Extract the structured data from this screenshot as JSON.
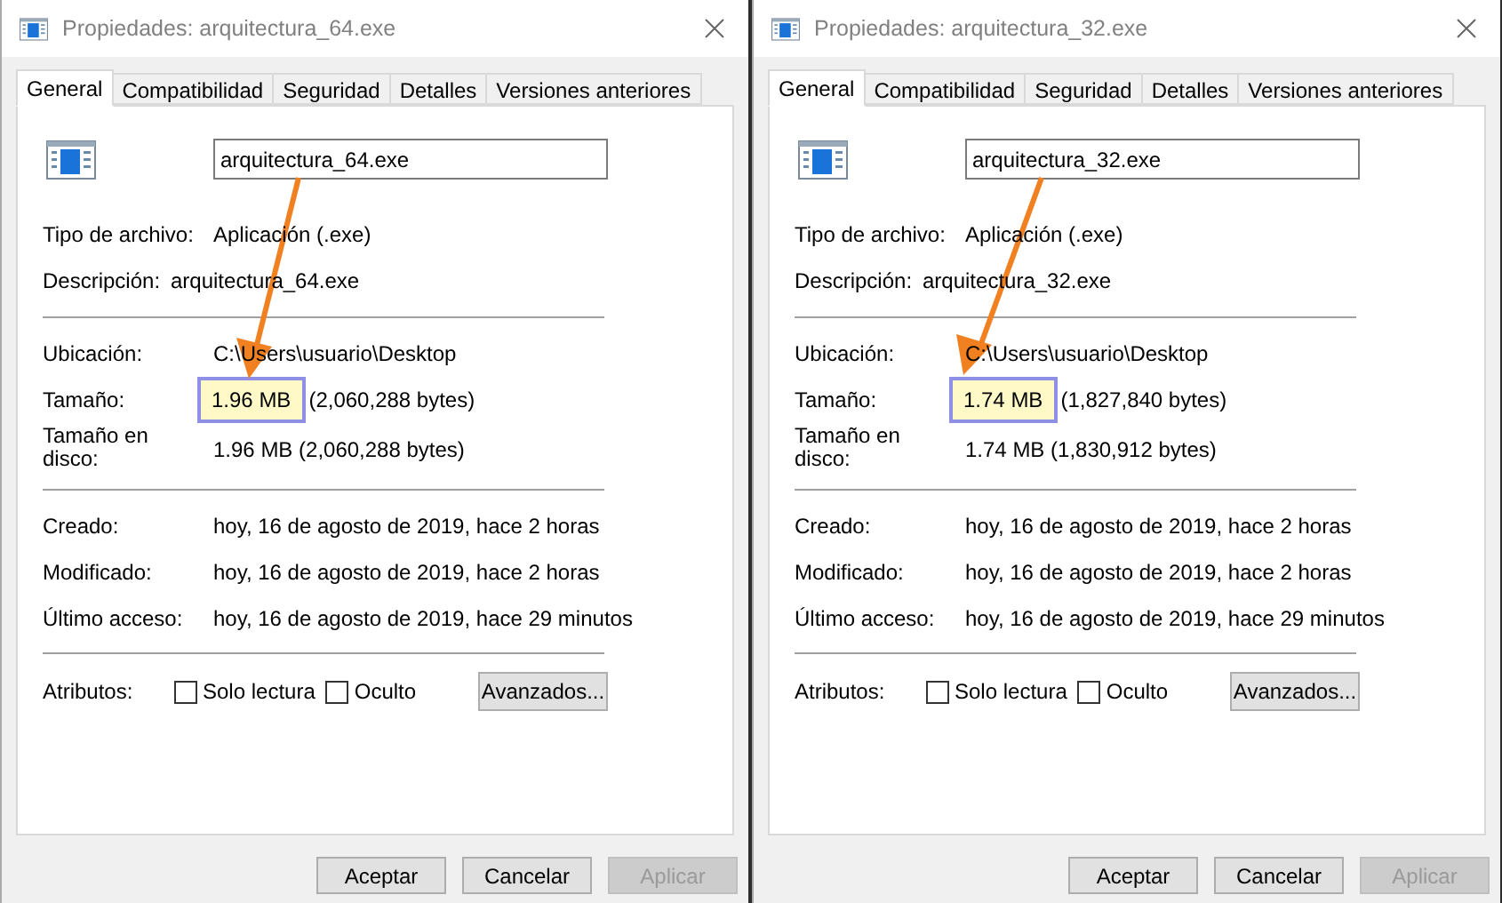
{
  "dialogs": [
    {
      "title": "Propiedades: arquitectura_64.exe",
      "tabs": [
        {
          "label": "General",
          "selected": true
        },
        {
          "label": "Compatibilidad",
          "selected": false
        },
        {
          "label": "Seguridad",
          "selected": false
        },
        {
          "label": "Detalles",
          "selected": false
        },
        {
          "label": "Versiones anteriores",
          "selected": false
        }
      ],
      "filename": "arquitectura_64.exe",
      "sections": [
        [
          {
            "label": "Tipo de archivo:",
            "value": "Aplicación (.exe)",
            "kind": "normal"
          },
          {
            "label": "Descripción:",
            "value": "arquitectura_64.exe",
            "kind": "compact"
          }
        ],
        [
          {
            "label": "Ubicación:",
            "value": "C:\\Users\\usuario\\Desktop",
            "kind": "normal"
          },
          {
            "label": "Tamaño:",
            "value": "1.96 MB",
            "extra": "(2,060,288 bytes)",
            "kind": "normal",
            "highlighted": true
          },
          {
            "label": "Tamaño en disco:",
            "value": "1.96 MB (2,060,288 bytes)",
            "kind": "wrapped"
          }
        ],
        [
          {
            "label": "Creado:",
            "value": "hoy, 16 de agosto de 2019, hace 2 horas",
            "kind": "normal"
          },
          {
            "label": "Modificado:",
            "value": "hoy, 16 de agosto de 2019, hace 2 horas",
            "kind": "normal"
          },
          {
            "label": "Último acceso:",
            "value": "hoy, 16 de agosto de 2019, hace 29 minutos",
            "kind": "normal"
          }
        ]
      ],
      "attributes": {
        "label": "Atributos:",
        "checkboxes": [
          {
            "label": "Solo lectura",
            "checked": false
          },
          {
            "label": "Oculto",
            "checked": false
          }
        ],
        "button": "Avanzados..."
      },
      "buttons": [
        {
          "label": "Aceptar",
          "disabled": false
        },
        {
          "label": "Cancelar",
          "disabled": false
        },
        {
          "label": "Aplicar",
          "disabled": true
        }
      ]
    },
    {
      "title": "Propiedades: arquitectura_32.exe",
      "tabs": [
        {
          "label": "General",
          "selected": true
        },
        {
          "label": "Compatibilidad",
          "selected": false
        },
        {
          "label": "Seguridad",
          "selected": false
        },
        {
          "label": "Detalles",
          "selected": false
        },
        {
          "label": "Versiones anteriores",
          "selected": false
        }
      ],
      "filename": "arquitectura_32.exe",
      "sections": [
        [
          {
            "label": "Tipo de archivo:",
            "value": "Aplicación (.exe)",
            "kind": "normal"
          },
          {
            "label": "Descripción:",
            "value": "arquitectura_32.exe",
            "kind": "compact"
          }
        ],
        [
          {
            "label": "Ubicación:",
            "value": "C:\\Users\\usuario\\Desktop",
            "kind": "normal"
          },
          {
            "label": "Tamaño:",
            "value": "1.74 MB",
            "extra": "(1,827,840 bytes)",
            "kind": "normal",
            "highlighted": true
          },
          {
            "label": "Tamaño en disco:",
            "value": "1.74 MB (1,830,912 bytes)",
            "kind": "wrapped"
          }
        ],
        [
          {
            "label": "Creado:",
            "value": "hoy, 16 de agosto de 2019, hace 2 horas",
            "kind": "normal"
          },
          {
            "label": "Modificado:",
            "value": "hoy, 16 de agosto de 2019, hace 2 horas",
            "kind": "normal"
          },
          {
            "label": "Último acceso:",
            "value": "hoy, 16 de agosto de 2019, hace 29 minutos",
            "kind": "normal"
          }
        ]
      ],
      "attributes": {
        "label": "Atributos:",
        "checkboxes": [
          {
            "label": "Solo lectura",
            "checked": false
          },
          {
            "label": "Oculto",
            "checked": false
          }
        ],
        "button": "Avanzados..."
      },
      "buttons": [
        {
          "label": "Aceptar",
          "disabled": false
        },
        {
          "label": "Cancelar",
          "disabled": false
        },
        {
          "label": "Aplicar",
          "disabled": true
        }
      ]
    }
  ]
}
